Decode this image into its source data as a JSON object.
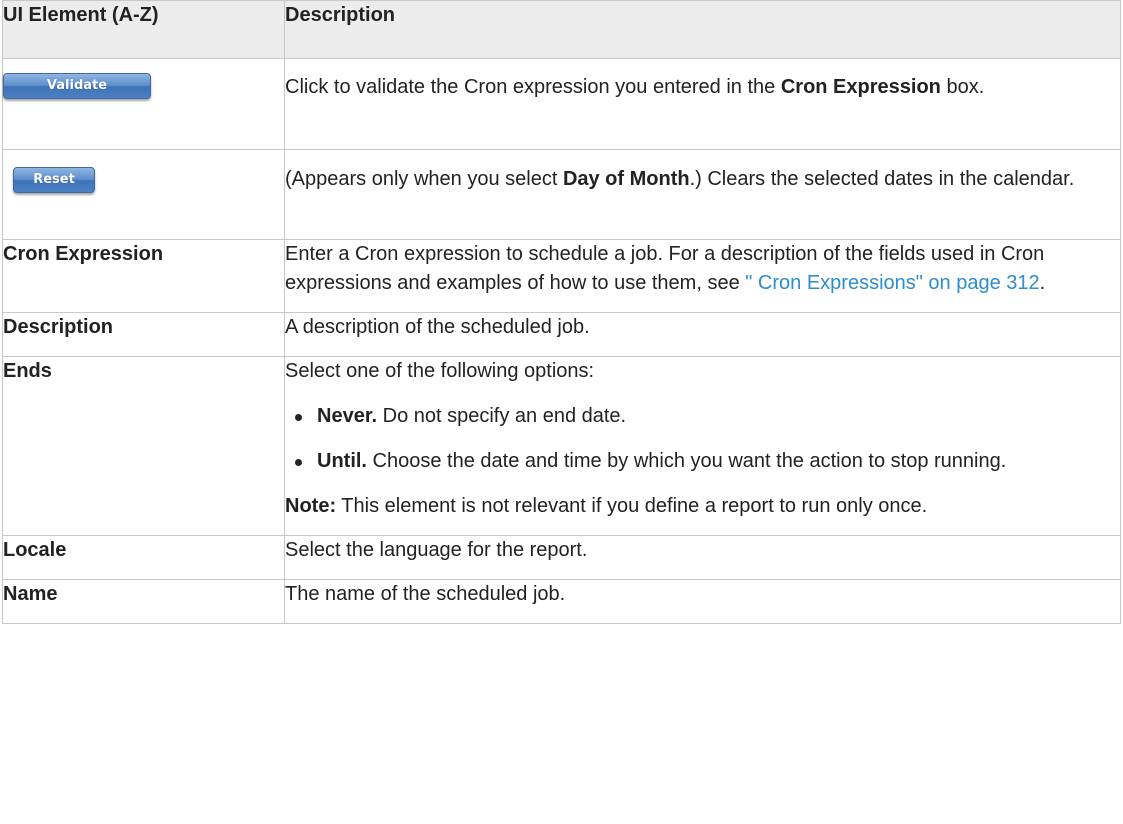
{
  "headers": {
    "element": "UI Element (A-Z)",
    "description": "Description"
  },
  "rows": {
    "validate": {
      "button_label": "Validate",
      "desc_pre": "Click to validate the Cron expression you entered in the ",
      "desc_bold": "Cron Expression",
      "desc_post": " box."
    },
    "reset": {
      "button_label": "Reset",
      "desc_pre": "(Appears only when you select ",
      "desc_bold": "Day of Month",
      "desc_post": ".) Clears the selected dates in the calendar."
    },
    "cron": {
      "element": "Cron Expression",
      "desc_pre": "Enter a Cron expression to schedule a job. For a description of the fields used in Cron expressions and examples of how to use them, see ",
      "link": "\" Cron Expressions\" on page 312",
      "desc_post": "."
    },
    "description": {
      "element": "Description",
      "desc": "A description of the scheduled job."
    },
    "ends": {
      "element": "Ends",
      "intro": "Select one of the following options:",
      "options": [
        {
          "label": "Never.",
          "text": " Do not specify an end date."
        },
        {
          "label": "Until.",
          "text": " Choose the date and time by which you want the action to stop running."
        }
      ],
      "note_label": "Note:",
      "note_text": " This element is not relevant if you define a report to run only once."
    },
    "locale": {
      "element": "Locale",
      "desc": "Select the language for the report."
    },
    "name": {
      "element": "Name",
      "desc": "The name of the scheduled job."
    }
  },
  "colors": {
    "link": "#2d8ecb",
    "header_bg": "#ececec",
    "border": "#c8c8c8",
    "button_blue": "#4c80c4"
  }
}
